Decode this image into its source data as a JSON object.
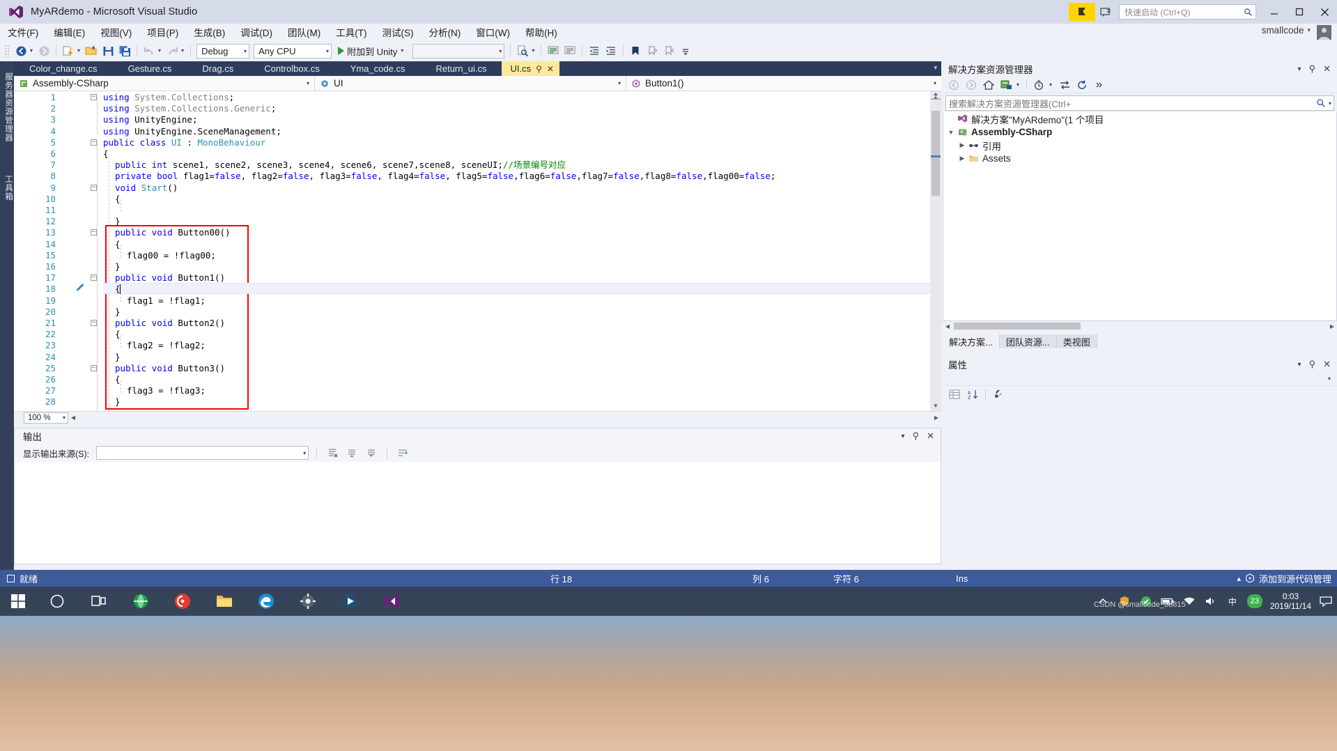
{
  "window": {
    "title": "MyARdemo - Microsoft Visual Studio",
    "logo_icon": "visual-studio-icon",
    "minimize_icon": "minimize-icon",
    "maximize_icon": "maximize-icon",
    "close_icon": "close-icon",
    "flag_icon": "feedback-flag-icon",
    "feedback_icon": "send-feedback-icon"
  },
  "quick_launch": {
    "placeholder": "快速启动 (Ctrl+Q)",
    "search_icon": "search-icon"
  },
  "account": {
    "name": "smallcode",
    "caret": "▾",
    "avatar_icon": "user-avatar-icon"
  },
  "menu": {
    "items": [
      "文件(F)",
      "编辑(E)",
      "视图(V)",
      "项目(P)",
      "生成(B)",
      "调试(D)",
      "团队(M)",
      "工具(T)",
      "测试(S)",
      "分析(N)",
      "窗口(W)",
      "帮助(H)"
    ]
  },
  "toolbar": {
    "nav_back_icon": "navigate-back-icon",
    "nav_forward_icon": "navigate-forward-icon",
    "new_project_icon": "new-project-icon",
    "open_file_icon": "open-file-icon",
    "save_icon": "save-icon",
    "save_all_icon": "save-all-icon",
    "undo_icon": "undo-icon",
    "redo_icon": "redo-icon",
    "config_value": "Debug",
    "platform_value": "Any CPU",
    "run_label": "附加到 Unity",
    "run_icon": "play-icon",
    "blank_combo_value": "",
    "find_icon": "find-in-files-icon",
    "comment_icon": "comment-selection-icon",
    "uncomment_icon": "uncomment-selection-icon",
    "outdent_icon": "outdent-icon",
    "indent_icon": "indent-icon",
    "bookmark_icon": "bookmark-icon",
    "prev_bookmark_icon": "previous-bookmark-icon",
    "next_bookmark_icon": "next-bookmark-icon",
    "overflow_icon": "toolbar-overflow-icon"
  },
  "left_rail": {
    "tabs": [
      "服务器资源管理器",
      "工具箱"
    ]
  },
  "doc_tabs": {
    "items": [
      {
        "label": "Color_change.cs",
        "active": false
      },
      {
        "label": "Gesture.cs",
        "active": false
      },
      {
        "label": "Drag.cs",
        "active": false
      },
      {
        "label": "Controlbox.cs",
        "active": false
      },
      {
        "label": "Yma_code.cs",
        "active": false
      },
      {
        "label": "Return_ui.cs",
        "active": false
      },
      {
        "label": "UI.cs",
        "active": true
      }
    ],
    "active_pin_icon": "pin-icon",
    "active_close_icon": "close-icon",
    "overflow_caret": "▾"
  },
  "nav_bar": {
    "project": {
      "value": "Assembly-CSharp",
      "icon": "csharp-project-icon",
      "caret": "▾"
    },
    "type": {
      "value": "UI",
      "icon": "class-icon",
      "caret": "▾"
    },
    "member": {
      "value": "Button1()",
      "icon": "method-icon",
      "caret": "▾"
    }
  },
  "code": {
    "language": "csharp",
    "lines": [
      {
        "n": 1,
        "indent": 0,
        "fold": "minus",
        "tokens": [
          {
            "t": "using ",
            "c": "k"
          },
          {
            "t": "System",
            "c": "g"
          },
          {
            "t": ".",
            "c": "g"
          },
          {
            "t": "Collections",
            "c": "g"
          },
          {
            "t": ";",
            "c": "p"
          }
        ]
      },
      {
        "n": 2,
        "indent": 0,
        "tokens": [
          {
            "t": "using ",
            "c": "k"
          },
          {
            "t": "System.Collections.Generic",
            "c": "g"
          },
          {
            "t": ";",
            "c": "p"
          }
        ]
      },
      {
        "n": 3,
        "indent": 0,
        "tokens": [
          {
            "t": "using ",
            "c": "k"
          },
          {
            "t": "UnityEngine",
            "c": "p"
          },
          {
            "t": ";",
            "c": "p"
          }
        ]
      },
      {
        "n": 4,
        "indent": 0,
        "tokens": [
          {
            "t": "using ",
            "c": "k"
          },
          {
            "t": "UnityEngine.SceneManagement",
            "c": "p"
          },
          {
            "t": ";",
            "c": "p"
          }
        ]
      },
      {
        "n": 5,
        "indent": 0,
        "fold": "minus",
        "tokens": [
          {
            "t": "public class ",
            "c": "k"
          },
          {
            "t": "UI",
            "c": "t"
          },
          {
            "t": " : ",
            "c": "p"
          },
          {
            "t": "MonoBehaviour",
            "c": "t"
          }
        ]
      },
      {
        "n": 6,
        "indent": 0,
        "tokens": [
          {
            "t": "{",
            "c": "p"
          }
        ]
      },
      {
        "n": 7,
        "indent": 1,
        "tokens": [
          {
            "t": "public int ",
            "c": "k"
          },
          {
            "t": "scene1, scene2, scene3, scene4, scene6, scene7,scene8, sceneUI;",
            "c": "p"
          },
          {
            "t": "//场景编号对应",
            "c": "c"
          }
        ]
      },
      {
        "n": 8,
        "indent": 1,
        "tokens": [
          {
            "t": "private bool ",
            "c": "k"
          },
          {
            "t": "flag1=",
            "c": "p"
          },
          {
            "t": "false",
            "c": "k"
          },
          {
            "t": ", flag2=",
            "c": "p"
          },
          {
            "t": "false",
            "c": "k"
          },
          {
            "t": ", flag3=",
            "c": "p"
          },
          {
            "t": "false",
            "c": "k"
          },
          {
            "t": ", flag4=",
            "c": "p"
          },
          {
            "t": "false",
            "c": "k"
          },
          {
            "t": ", flag5=",
            "c": "p"
          },
          {
            "t": "false",
            "c": "k"
          },
          {
            "t": ",flag6=",
            "c": "p"
          },
          {
            "t": "false",
            "c": "k"
          },
          {
            "t": ",flag7=",
            "c": "p"
          },
          {
            "t": "false",
            "c": "k"
          },
          {
            "t": ",flag8=",
            "c": "p"
          },
          {
            "t": "false",
            "c": "k"
          },
          {
            "t": ",flag00=",
            "c": "p"
          },
          {
            "t": "false",
            "c": "k"
          },
          {
            "t": ";",
            "c": "p"
          }
        ]
      },
      {
        "n": 9,
        "indent": 1,
        "fold": "minus",
        "tokens": [
          {
            "t": "void ",
            "c": "k"
          },
          {
            "t": "Start",
            "c": "t"
          },
          {
            "t": "()",
            "c": "p"
          }
        ]
      },
      {
        "n": 10,
        "indent": 1,
        "tokens": [
          {
            "t": "{",
            "c": "p"
          }
        ]
      },
      {
        "n": 11,
        "indent": 2,
        "tokens": [
          {
            "t": "",
            "c": "p"
          }
        ]
      },
      {
        "n": 12,
        "indent": 1,
        "tokens": [
          {
            "t": "}",
            "c": "p"
          }
        ]
      },
      {
        "n": 13,
        "indent": 1,
        "fold": "minus",
        "tokens": [
          {
            "t": "public void ",
            "c": "k"
          },
          {
            "t": "Button00()",
            "c": "p"
          }
        ]
      },
      {
        "n": 14,
        "indent": 1,
        "tokens": [
          {
            "t": "{",
            "c": "p"
          }
        ]
      },
      {
        "n": 15,
        "indent": 2,
        "tokens": [
          {
            "t": "flag00 = !flag00;",
            "c": "p"
          }
        ]
      },
      {
        "n": 16,
        "indent": 1,
        "tokens": [
          {
            "t": "}",
            "c": "p"
          }
        ]
      },
      {
        "n": 17,
        "indent": 1,
        "fold": "minus",
        "tokens": [
          {
            "t": "public void ",
            "c": "k"
          },
          {
            "t": "Button1()",
            "c": "p"
          }
        ]
      },
      {
        "n": 18,
        "indent": 1,
        "current": true,
        "tokens": [
          {
            "t": "{",
            "c": "p"
          }
        ]
      },
      {
        "n": 19,
        "indent": 2,
        "tokens": [
          {
            "t": "flag1 = !flag1;",
            "c": "p"
          }
        ]
      },
      {
        "n": 20,
        "indent": 1,
        "tokens": [
          {
            "t": "}",
            "c": "p"
          }
        ]
      },
      {
        "n": 21,
        "indent": 1,
        "fold": "minus",
        "tokens": [
          {
            "t": "public void ",
            "c": "k"
          },
          {
            "t": "Button2()",
            "c": "p"
          }
        ]
      },
      {
        "n": 22,
        "indent": 1,
        "tokens": [
          {
            "t": "{",
            "c": "p"
          }
        ]
      },
      {
        "n": 23,
        "indent": 2,
        "tokens": [
          {
            "t": "flag2 = !flag2;",
            "c": "p"
          }
        ]
      },
      {
        "n": 24,
        "indent": 1,
        "tokens": [
          {
            "t": "}",
            "c": "p"
          }
        ]
      },
      {
        "n": 25,
        "indent": 1,
        "fold": "minus",
        "tokens": [
          {
            "t": "public void ",
            "c": "k"
          },
          {
            "t": "Button3()",
            "c": "p"
          }
        ]
      },
      {
        "n": 26,
        "indent": 1,
        "tokens": [
          {
            "t": "{",
            "c": "p"
          }
        ]
      },
      {
        "n": 27,
        "indent": 2,
        "tokens": [
          {
            "t": "flag3 = !flag3;",
            "c": "p"
          }
        ]
      },
      {
        "n": 28,
        "indent": 1,
        "tokens": [
          {
            "t": "}",
            "c": "p"
          }
        ]
      }
    ],
    "annotation": {
      "color": "#ff0000",
      "shape": "rectangle",
      "from_line": 13,
      "to_line": 28
    },
    "breakpoint_gutter_icon": "edit-marker-icon"
  },
  "editor_footer": {
    "zoom": "100 %",
    "zoom_caret": "▾"
  },
  "output": {
    "title": "输出",
    "caret_icon": "chevron-down-icon",
    "pin_icon": "pin-icon",
    "close_icon": "close-icon",
    "source_label": "显示输出来源(S):",
    "source_value": "",
    "source_caret": "▾",
    "clear_icon": "clear-all-icon",
    "goto_prev_icon": "go-to-previous-message-icon",
    "goto_next_icon": "go-to-next-message-icon",
    "wordwrap_icon": "toggle-word-wrap-icon",
    "body_text": ""
  },
  "solution_explorer": {
    "title": "解决方案资源管理器",
    "caret_icon": "chevron-down-icon",
    "pin_icon": "pin-icon",
    "close_icon": "close-icon",
    "toolbar": {
      "back_icon": "back-icon",
      "forward_icon": "forward-icon",
      "home_icon": "home-icon",
      "properties_icon": "properties-window-icon",
      "pending_changes_icon": "pending-changes-filter-icon",
      "sync_icon": "sync-with-active-document-icon",
      "refresh_icon": "refresh-icon",
      "overflow_icon": "toolbar-overflow-icon"
    },
    "search": {
      "placeholder": "搜索解决方案资源管理器(Ctrl+",
      "icon": "search-icon",
      "caret": "▾"
    },
    "tree": [
      {
        "depth": 0,
        "expander": "",
        "icon": "solution-icon",
        "label": "解决方案\"MyARdemo\"(1 个项目",
        "bold": false,
        "selected": false
      },
      {
        "depth": 0,
        "expander": "▼",
        "icon": "csharp-project-icon",
        "label": "Assembly-CSharp",
        "bold": true,
        "selected": false
      },
      {
        "depth": 1,
        "expander": "▶",
        "icon": "references-icon",
        "label": "引用",
        "bold": false,
        "selected": false
      },
      {
        "depth": 1,
        "expander": "▶",
        "icon": "folder-icon",
        "label": "Assets",
        "bold": false,
        "selected": false
      }
    ],
    "tabs": [
      {
        "label": "解决方案...",
        "active": true
      },
      {
        "label": "团队资源...",
        "active": false
      },
      {
        "label": "类视图",
        "active": false
      }
    ]
  },
  "properties": {
    "title": "属性",
    "caret_icon": "chevron-down-icon",
    "pin_icon": "pin-icon",
    "close_icon": "close-icon",
    "toolbar": {
      "categorized_icon": "categorized-view-icon",
      "alphabetical_icon": "alphabetical-view-icon",
      "properties_icon": "properties-icon"
    }
  },
  "status_bar": {
    "ready": "就绪",
    "ready_icon": "ready-icon",
    "line_label": "行 18",
    "column_label": "列 6",
    "char_label": "字符 6",
    "insert_mode": "Ins",
    "source_control": "添加到源代码管理",
    "source_control_caret": "▴",
    "source_control_icon": "source-control-icon"
  },
  "taskbar": {
    "start_icon": "windows-start-icon",
    "items": [
      {
        "icon": "cortana-search-icon",
        "name": "cortana"
      },
      {
        "icon": "task-view-icon",
        "name": "task-view"
      },
      {
        "icon": "browser-globe-icon",
        "name": "app-green"
      },
      {
        "icon": "music-app-icon",
        "name": "app-red"
      },
      {
        "icon": "file-explorer-icon",
        "name": "file-explorer"
      },
      {
        "icon": "edge-browser-icon",
        "name": "edge"
      },
      {
        "icon": "settings-gear-icon",
        "name": "settings"
      },
      {
        "icon": "media-player-icon",
        "name": "media-player"
      },
      {
        "icon": "visual-studio-icon",
        "name": "visual-studio"
      }
    ],
    "tray": {
      "up_arrow_icon": "show-hidden-icons-icon",
      "shield_icon": "security-icon",
      "shield2_icon": "app-tray-icon",
      "battery_icon": "battery-icon",
      "network_icon": "network-icon",
      "volume_icon": "volume-icon",
      "ime_icon": "ime-icon",
      "badge": "23",
      "notification_icon": "action-center-icon",
      "time": "0:03",
      "date": "2019/11/14"
    },
    "watermark": "CSDN @smallcode_38815"
  }
}
